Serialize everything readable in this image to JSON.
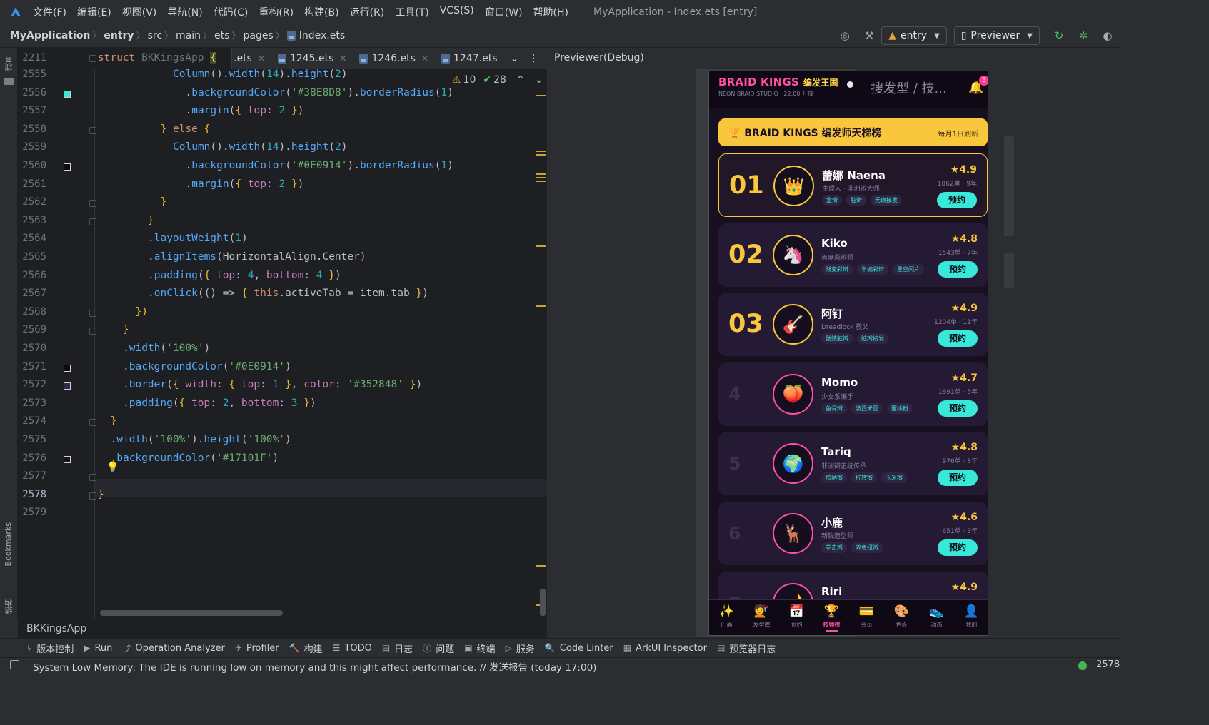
{
  "menu": {
    "items": [
      "文件(F)",
      "编辑(E)",
      "视图(V)",
      "导航(N)",
      "代码(C)",
      "重构(R)",
      "构建(B)",
      "运行(R)",
      "工具(T)",
      "VCS(S)",
      "窗口(W)",
      "帮助(H)"
    ],
    "window_title": "MyApplication - Index.ets [entry]"
  },
  "breadcrumb": [
    "MyApplication",
    "entry",
    "src",
    "main",
    "ets",
    "pages",
    "Index.ets"
  ],
  "run_config": "entry",
  "previewer_label": "Previewer",
  "sticky_header": {
    "line": "2211",
    "text_kw": "struct",
    "text_name": "BKKingsApp",
    "text_brace": "{"
  },
  "tabs": [
    ".ets",
    "1245.ets",
    "1246.ets",
    "1247.ets"
  ],
  "inspection": {
    "warnings": "10",
    "weak_warnings": "28"
  },
  "code_lines": [
    {
      "n": "2555",
      "html": "<span class=\"f\">Column</span>().<span class=\"f\">width</span>(<span class=\"n\">14</span>).<span class=\"f\">height</span>(<span class=\"n\">2</span>)",
      "indent": 6
    },
    {
      "n": "2556",
      "html": ".<span class=\"f\">backgroundColor</span>(<span class=\"s\">'#38E8D8'</span>).<span class=\"f\">borderRadius</span>(<span class=\"n\">1</span>)",
      "indent": 7,
      "swatch": "#38E8D8"
    },
    {
      "n": "2557",
      "html": ".<span class=\"f\">margin</span>(<span class=\"y\">{</span> <span class=\"p\">top</span>: <span class=\"n\">2</span> <span class=\"y\">}</span>)",
      "indent": 7
    },
    {
      "n": "2558",
      "html": "<span class=\"y\">}</span> <span class=\"k\">else</span> <span class=\"y\">{</span>",
      "indent": 5,
      "fold": true
    },
    {
      "n": "2559",
      "html": "<span class=\"f\">Column</span>().<span class=\"f\">width</span>(<span class=\"n\">14</span>).<span class=\"f\">height</span>(<span class=\"n\">2</span>)",
      "indent": 6
    },
    {
      "n": "2560",
      "html": ".<span class=\"f\">backgroundColor</span>(<span class=\"s\">'#0E0914'</span>).<span class=\"f\">borderRadius</span>(<span class=\"n\">1</span>)",
      "indent": 7,
      "swatch": "#0E0914"
    },
    {
      "n": "2561",
      "html": ".<span class=\"f\">margin</span>(<span class=\"y\">{</span> <span class=\"p\">top</span>: <span class=\"n\">2</span> <span class=\"y\">}</span>)",
      "indent": 7
    },
    {
      "n": "2562",
      "html": "<span class=\"y\">}</span>",
      "indent": 5,
      "fold": true
    },
    {
      "n": "2563",
      "html": "<span class=\"y\">}</span>",
      "indent": 4,
      "fold": true
    },
    {
      "n": "2564",
      "html": ".<span class=\"f\">layoutWeight</span>(<span class=\"n\">1</span>)",
      "indent": 4
    },
    {
      "n": "2565",
      "html": ".<span class=\"f\">alignItems</span>(<span class=\"t\">HorizontalAlign</span>.<span class=\"t\">Center</span>)",
      "indent": 4
    },
    {
      "n": "2566",
      "html": ".<span class=\"f\">padding</span>(<span class=\"y\">{</span> <span class=\"p\">top</span>: <span class=\"n\">4</span>, <span class=\"p\">bottom</span>: <span class=\"n\">4</span> <span class=\"y\">}</span>)",
      "indent": 4
    },
    {
      "n": "2567",
      "html": ".<span class=\"f\">onClick</span>(() => <span class=\"y\">{</span> <span class=\"k\">this</span>.<span class=\"t\">activeTab</span> = <span class=\"t\">item</span>.<span class=\"t\">tab</span> <span class=\"y\">}</span>)",
      "indent": 4
    },
    {
      "n": "2568",
      "html": "<span class=\"y\">})</span>",
      "indent": 3,
      "fold": true
    },
    {
      "n": "2569",
      "html": "<span class=\"y\">}</span>",
      "indent": 2,
      "fold": true
    },
    {
      "n": "2570",
      "html": ".<span class=\"f\">width</span>(<span class=\"s\">'100%'</span>)",
      "indent": 2
    },
    {
      "n": "2571",
      "html": ".<span class=\"f\">backgroundColor</span>(<span class=\"s\">'#0E0914'</span>)",
      "indent": 2,
      "swatch": "#0E0914"
    },
    {
      "n": "2572",
      "html": ".<span class=\"f\">border</span>(<span class=\"y\">{</span> <span class=\"p\">width</span>: <span class=\"y\">{</span> <span class=\"p\">top</span>: <span class=\"n\">1</span> <span class=\"y\">}</span>, <span class=\"p\">color</span>: <span class=\"s\">'#352848'</span> <span class=\"y\">}</span>)",
      "indent": 2,
      "swatch": "#352848"
    },
    {
      "n": "2573",
      "html": ".<span class=\"f\">padding</span>(<span class=\"y\">{</span> <span class=\"p\">top</span>: <span class=\"n\">2</span>, <span class=\"p\">bottom</span>: <span class=\"n\">3</span> <span class=\"y\">}</span>)",
      "indent": 2
    },
    {
      "n": "2574",
      "html": "<span class=\"y\">}</span>",
      "indent": 1,
      "fold": true
    },
    {
      "n": "2575",
      "html": ".<span class=\"f\">width</span>(<span class=\"s\">'100%'</span>).<span class=\"f\">height</span>(<span class=\"s\">'100%'</span>)",
      "indent": 1
    },
    {
      "n": "2576",
      "html": ".<span class=\"f\">backgroundColor</span>(<span class=\"s\">'#17101F'</span>)",
      "indent": 1,
      "swatch": "#17101F"
    },
    {
      "n": "2577",
      "html": "",
      "indent": 0,
      "fold": true
    },
    {
      "n": "2578",
      "html": "<span class=\"y\">}</span>",
      "indent": 0,
      "fold": true,
      "current": true
    },
    {
      "n": "2579",
      "html": "",
      "indent": 0
    }
  ],
  "previewer_title": "Previewer(Debug)",
  "app": {
    "brand": "BRAID KINGS",
    "brand_cn": "编发王国",
    "studio": "NEON BRAID STUDIO · 22:00 开放",
    "search": "搜发型 / 技...",
    "notif_count": "5",
    "banner_title": "🏆 BRAID KINGS 编发师天梯榜",
    "banner_sub": "每月1日刷新",
    "book_label": "预约",
    "stylists": [
      {
        "rank": "01",
        "name": "蕾娜 Naena",
        "sub": "主理人 · 非洲辫大师",
        "tags": [
          "盒辫",
          "脏辫",
          "无痕接发"
        ],
        "rating": "★4.9",
        "meta": "1862单 · 9年",
        "avatar": "👑"
      },
      {
        "rank": "02",
        "name": "Kiko",
        "sub": "首席彩辫师",
        "tags": [
          "渐变彩辫",
          "半编彩辫",
          "星空闪片"
        ],
        "rating": "★4.8",
        "meta": "1543单 · 7年",
        "avatar": "🦄"
      },
      {
        "rank": "03",
        "name": "阿钉",
        "sub": "Dreadlock 教父",
        "tags": [
          "骷髅脏辫",
          "脏辫接发"
        ],
        "rating": "★4.9",
        "meta": "1204单 · 11年",
        "avatar": "🎸"
      },
      {
        "rank": "4",
        "name": "Momo",
        "sub": "少女系编手",
        "tags": [
          "鱼骨辫",
          "波西米亚",
          "蜜桃粉"
        ],
        "rating": "★4.7",
        "meta": "1891单 · 5年",
        "avatar": "🍑"
      },
      {
        "rank": "5",
        "name": "Tariq",
        "sub": "非洲辫正统传承",
        "tags": [
          "加纳辫",
          "拧转辫",
          "玉米辫"
        ],
        "rating": "★4.8",
        "meta": "976单 · 8年",
        "avatar": "🌍"
      },
      {
        "rank": "6",
        "name": "小鹿",
        "sub": "新锐造型师",
        "tags": [
          "拳击辫",
          "双色扭辫"
        ],
        "rating": "★4.6",
        "meta": "651单 · 3年",
        "avatar": "🦌"
      },
      {
        "rank": "7",
        "name": "Riri",
        "sub": "",
        "tags": [],
        "rating": "★4.9",
        "meta": "",
        "avatar": "🌙"
      }
    ],
    "tabbar": [
      {
        "label": "门面",
        "icon": "✨"
      },
      {
        "label": "发型库",
        "icon": "💇"
      },
      {
        "label": "预约",
        "icon": "📅"
      },
      {
        "label": "技师榜",
        "icon": "🏆",
        "active": true
      },
      {
        "label": "会员",
        "icon": "💳"
      },
      {
        "label": "色板",
        "icon": "🎨"
      },
      {
        "label": "动态",
        "icon": "👟"
      },
      {
        "label": "我的",
        "icon": "👤"
      }
    ]
  },
  "editor_crumb": "BKKingsApp",
  "tool_windows": [
    "版本控制",
    "Run",
    "Operation Analyzer",
    "Profiler",
    "构建",
    "TODO",
    "日志",
    "问题",
    "终端",
    "服务",
    "Code Linter",
    "ArkUI Inspector",
    "预览器日志"
  ],
  "side_labels": {
    "project": "项目",
    "bookmarks": "Bookmarks",
    "structure": "结构"
  },
  "status": {
    "message": "System Low Memory: The IDE is running low on memory and this might affect performance. // 发送报告 (today 17:00)",
    "position": "2578"
  }
}
